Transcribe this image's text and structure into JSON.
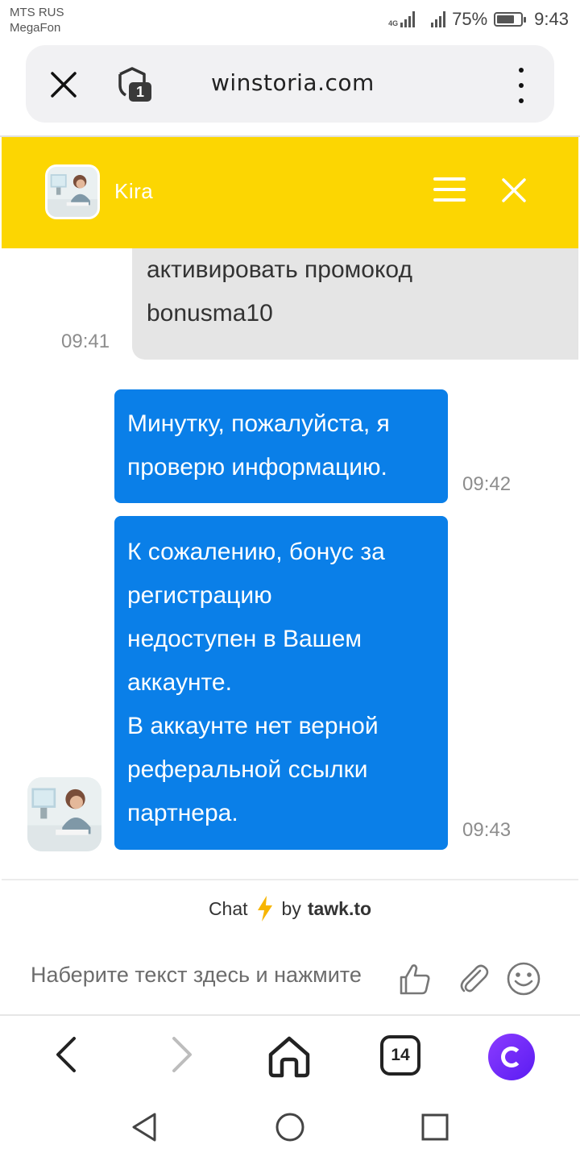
{
  "status_bar": {
    "carrier_line1": "MTS RUS",
    "carrier_line2": "MegaFon",
    "network_label": "4G",
    "battery_percent": "75%",
    "battery_level": 0.75,
    "time": "9:43"
  },
  "browser": {
    "url": "winstoria.com",
    "shield_badge": "1",
    "tabs_count": "14"
  },
  "chat": {
    "agent_name": "Kira",
    "messages": [
      {
        "direction": "incoming",
        "lines": [
          "активировать промокод",
          "bonusma10"
        ],
        "time": "09:41"
      },
      {
        "direction": "outgoing",
        "lines": [
          "Минутку, пожалуйста, я",
          "проверю информацию."
        ],
        "time": "09:42"
      },
      {
        "direction": "outgoing",
        "lines": [
          "К сожалению, бонус за",
          "регистрацию",
          "недоступен в Вашем",
          "аккаунте.",
          "В аккаунте нет верной",
          "реферальной ссылки",
          "партнера."
        ],
        "time": "09:43"
      }
    ],
    "branding": {
      "prefix": "Chat",
      "by": "by",
      "brand": "tawk.to"
    },
    "input_placeholder": "Наберите текст здесь и нажмите"
  },
  "icons": {
    "close": "close-icon",
    "shield": "shield-icon",
    "menu": "menu-icon",
    "like": "thumbs-up-icon",
    "attach": "paperclip-icon",
    "emoji": "smiley-icon",
    "bolt": "lightning-icon"
  },
  "colors": {
    "header": "#fcd602",
    "outgoing_bubble": "#0a7fe8",
    "incoming_bubble": "#e5e5e5",
    "alice": "#7a2ff7"
  }
}
